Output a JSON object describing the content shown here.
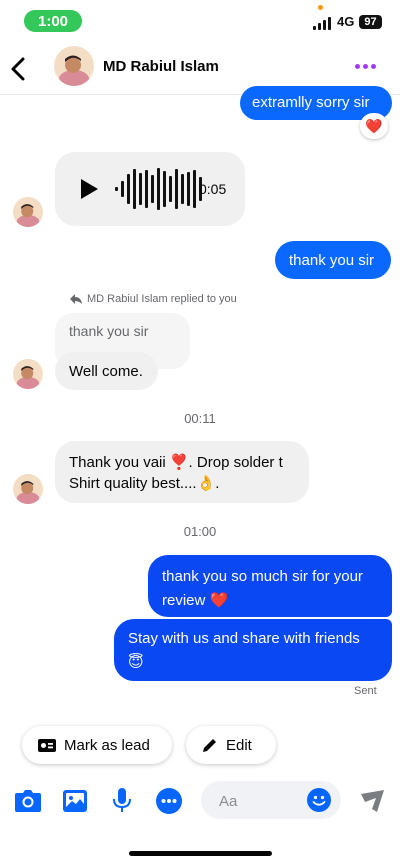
{
  "status_bar": {
    "time": "1:00",
    "network": "4G",
    "battery": "97"
  },
  "header": {
    "contact_name": "MD Rabiul Islam"
  },
  "messages": {
    "m1": {
      "text": "extramlly sorry sir",
      "reaction": "❤️"
    },
    "voice": {
      "duration": "0:05"
    },
    "m2": {
      "text": "thank you sir"
    },
    "reply": {
      "label": "MD Rabiul Islam replied to you",
      "quoted": "thank you sir",
      "text": "Well come."
    },
    "ts1": "00:11",
    "m4": {
      "text": "Thank you vaii ❣️. Drop solder t Shirt  quality best....👌."
    },
    "ts2": "01:00",
    "m5": {
      "text": "thank you so much sir for your review ❤️"
    },
    "m6": {
      "text": "Stay with us and share with friends 😇"
    },
    "status": "Sent"
  },
  "actions": {
    "mark_as_lead": "Mark as lead",
    "edit": "Edit"
  },
  "composer": {
    "placeholder": "Aa"
  },
  "colors": {
    "outgoing": "#0a68ff",
    "outgoing_dark": "#0948f2",
    "incoming": "#f0f0f0",
    "accent": "#0866ff",
    "menu_dots": "#a33bf4",
    "status_green": "#34c759"
  }
}
